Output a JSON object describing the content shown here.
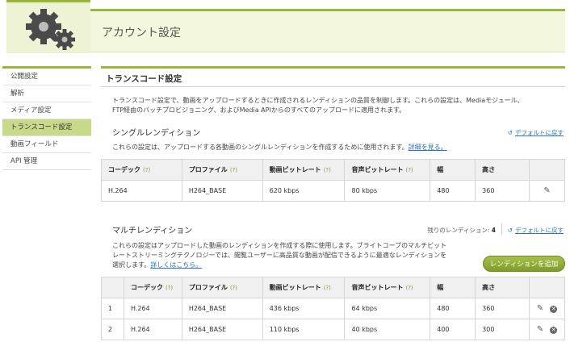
{
  "header": {
    "title": "アカウント設定"
  },
  "sidebar": {
    "items": [
      {
        "label": "公開設定"
      },
      {
        "label": "解析"
      },
      {
        "label": "メディア設定"
      },
      {
        "label": "トランスコード設定"
      },
      {
        "label": "動画フィールド"
      },
      {
        "label": "API 管理"
      }
    ],
    "active_index": 3
  },
  "transcode": {
    "title": "トランスコード設定",
    "desc_line1": "トランスコード設定で、動画をアップロードするときに作成されるレンディションの品質を制御します。これらの設定は、Mediaモジュール、",
    "desc_line2": "FTP経由のバッチプロビジョニング、およびMedia APIからのすべてのアップロードに適用されます。"
  },
  "single": {
    "title": "シングルレンディション",
    "reset_label": "デフォルトに戻す",
    "desc": "これらの設定は、アップロードする各動画のシングルレンディションを作成するために使用されます。",
    "desc_link": "詳細を見る。",
    "headers": [
      "コーデック",
      "プロファイル",
      "動画ビットレート",
      "音声ビットレート",
      "幅",
      "高さ"
    ],
    "help_mark": "(?)",
    "row": [
      "H.264",
      "H264_BASE",
      "620 kbps",
      "80 kbps",
      "480",
      "360"
    ]
  },
  "multi": {
    "title": "マルチレンディション",
    "remaining_label": "残りのレンディション:",
    "remaining_count": "4",
    "reset_label": "デフォルトに戻す",
    "desc_line1": "これらの設定はアップロードした動画のレンディションを作成する際に使用します。ブライトコーブのマルチビット",
    "desc_line2": "レートストリーミングテクノロジーでは、閲覧ユーザーに高品質な動画が配信できるように最適なレンディションを",
    "desc_line3": "選択します。",
    "desc_link": "詳しくはこちら。",
    "add_button": "レンディションを追加",
    "headers": [
      "コーデック",
      "プロファイル",
      "動画ビットレート",
      "音声ビットレート",
      "幅",
      "高さ"
    ],
    "help_mark": "(?)",
    "rows": [
      [
        "1",
        "H.264",
        "H264_BASE",
        "436 kbps",
        "64 kbps",
        "480",
        "360"
      ],
      [
        "2",
        "H.264",
        "H264_BASE",
        "110 kbps",
        "40 kbps",
        "400",
        "300"
      ]
    ]
  },
  "colors": {
    "accent": "#9bb53c",
    "header_bg": "#f3f7dc",
    "active_nav": "#c9d98a",
    "link": "#2a74b8"
  },
  "icons": {
    "logo": "gears-icon",
    "edit": "pencil-icon",
    "delete": "close-circle-icon",
    "reset": "reset-arrow-icon"
  }
}
